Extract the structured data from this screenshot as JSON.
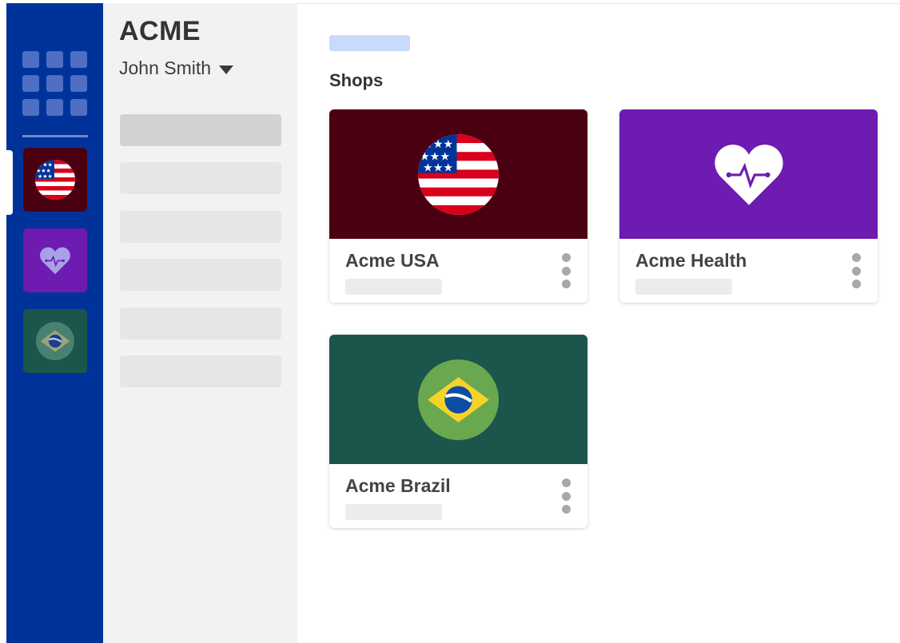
{
  "org": {
    "name": "ACME"
  },
  "user": {
    "name": "John Smith"
  },
  "main": {
    "section_title": "Shops"
  },
  "shops": [
    {
      "name": "Acme USA",
      "icon": "usa-flag-icon",
      "color": "#4b0012"
    },
    {
      "name": "Acme Health",
      "icon": "heart-pulse-icon",
      "color": "#6d1bb0"
    },
    {
      "name": "Acme Brazil",
      "icon": "brazil-flag-icon",
      "color": "#1c554b"
    }
  ],
  "colors": {
    "rail": "#00339a",
    "sidepanel": "#f2f2f2",
    "title_placeholder": "#c9dafa",
    "usa_flag_red": "#d8001b",
    "brazil_green": "#6aa84f",
    "brazil_yellow": "#f6d32b",
    "brazil_blue": "#0b4ea2"
  }
}
